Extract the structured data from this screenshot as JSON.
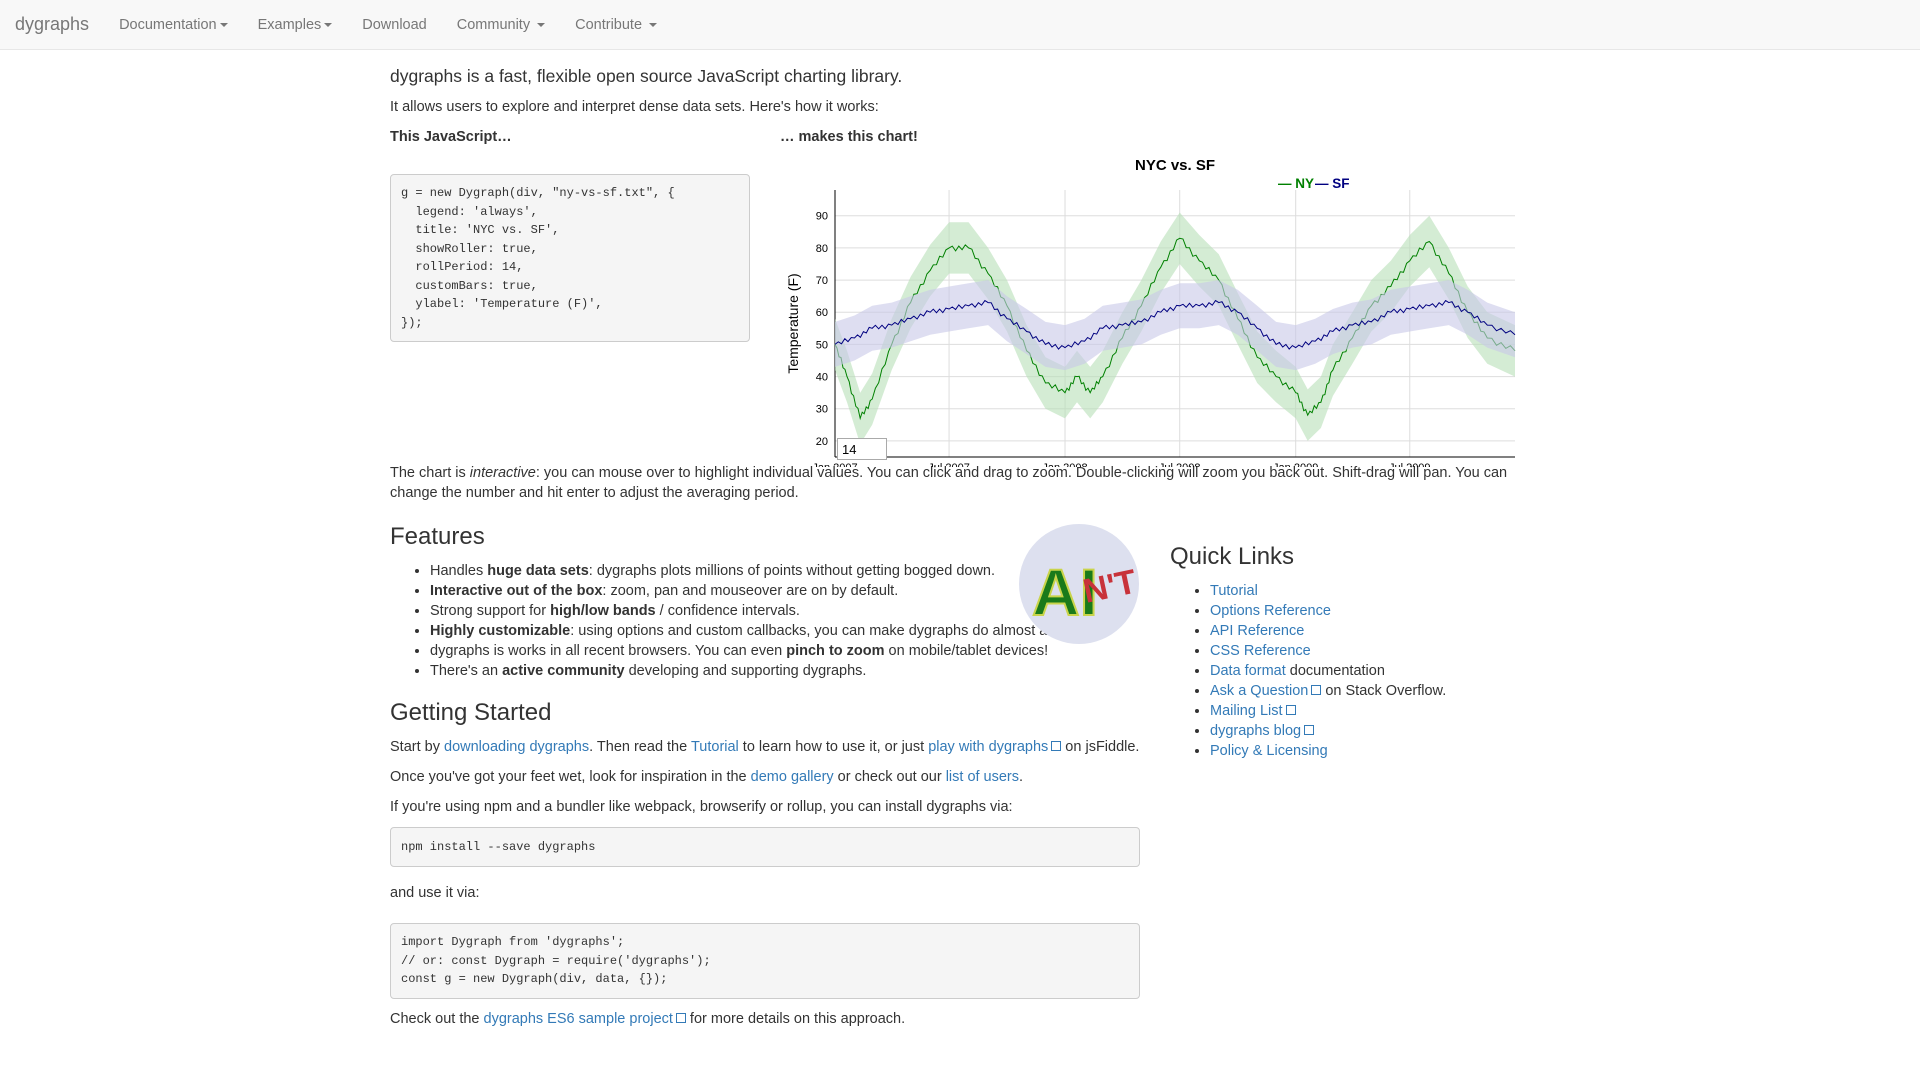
{
  "nav": {
    "brand": "dygraphs",
    "items": [
      {
        "label": "Documentation",
        "dropdown": true
      },
      {
        "label": "Examples",
        "dropdown": true
      },
      {
        "label": "Download",
        "dropdown": false
      },
      {
        "label": "Community",
        "dropdown": true
      },
      {
        "label": "Contribute",
        "dropdown": true
      }
    ]
  },
  "intro": {
    "lead": "dygraphs is a fast, flexible open source JavaScript charting library.",
    "sub": "It allows users to explore and interpret dense data sets. Here's how it works:"
  },
  "demo": {
    "js_heading": "This JavaScript…",
    "chart_heading": "… makes this chart!",
    "code": "g = new Dygraph(div, \"ny-vs-sf.txt\", {\n  legend: 'always',\n  title: 'NYC vs. SF',\n  showRoller: true,\n  rollPeriod: 14,\n  customBars: true,\n  ylabel: 'Temperature (F)',\n});",
    "interactive_before": "The chart is ",
    "interactive_em": "interactive",
    "interactive_after": ": you can mouse over to highlight individual values. You can click and drag to zoom. Double-clicking will zoom you back out. Shift-drag will pan. You can change the number and hit enter to adjust the averaging period."
  },
  "chart_data": {
    "type": "line",
    "title": "NYC vs. SF",
    "ylabel": "Temperature (F)",
    "xlabel": "",
    "x_ticks": [
      "Jan 2007",
      "Jul 2007",
      "Jan 2008",
      "Jul 2008",
      "Jan 2009",
      "Jul 2009"
    ],
    "y_ticks": [
      20,
      30,
      40,
      50,
      60,
      70,
      80,
      90
    ],
    "ylim": [
      15,
      98
    ],
    "xlim": [
      "2007-01-01",
      "2009-12-15"
    ],
    "legend_position": "top-right",
    "roller_value": "14",
    "series": [
      {
        "name": "NY",
        "color": "#008000",
        "band_color": "#b7dfb7",
        "points": [
          [
            "2007-01-01",
            50
          ],
          [
            "2007-01-20",
            40
          ],
          [
            "2007-02-10",
            27
          ],
          [
            "2007-03-01",
            33
          ],
          [
            "2007-04-01",
            50
          ],
          [
            "2007-05-01",
            63
          ],
          [
            "2007-06-01",
            73
          ],
          [
            "2007-07-01",
            80
          ],
          [
            "2007-08-01",
            80
          ],
          [
            "2007-09-01",
            72
          ],
          [
            "2007-10-01",
            62
          ],
          [
            "2007-11-01",
            48
          ],
          [
            "2007-12-01",
            38
          ],
          [
            "2008-01-01",
            35
          ],
          [
            "2008-01-20",
            40
          ],
          [
            "2008-02-10",
            35
          ],
          [
            "2008-03-01",
            40
          ],
          [
            "2008-04-01",
            52
          ],
          [
            "2008-05-01",
            62
          ],
          [
            "2008-06-01",
            74
          ],
          [
            "2008-07-01",
            83
          ],
          [
            "2008-08-01",
            76
          ],
          [
            "2008-09-01",
            70
          ],
          [
            "2008-10-01",
            58
          ],
          [
            "2008-11-01",
            46
          ],
          [
            "2008-12-01",
            40
          ],
          [
            "2009-01-01",
            35
          ],
          [
            "2009-01-20",
            28
          ],
          [
            "2009-02-10",
            32
          ],
          [
            "2009-03-01",
            42
          ],
          [
            "2009-04-01",
            52
          ],
          [
            "2009-05-01",
            62
          ],
          [
            "2009-06-01",
            68
          ],
          [
            "2009-07-01",
            76
          ],
          [
            "2009-08-01",
            82
          ],
          [
            "2009-09-01",
            72
          ],
          [
            "2009-10-01",
            60
          ],
          [
            "2009-11-01",
            52
          ],
          [
            "2009-12-15",
            48
          ]
        ]
      },
      {
        "name": "SF",
        "color": "#000080",
        "band_color": "#c8c8e8",
        "points": [
          [
            "2007-01-01",
            50
          ],
          [
            "2007-02-01",
            52
          ],
          [
            "2007-03-01",
            55
          ],
          [
            "2007-04-01",
            56
          ],
          [
            "2007-05-01",
            58
          ],
          [
            "2007-06-01",
            60
          ],
          [
            "2007-07-01",
            61
          ],
          [
            "2007-08-01",
            62
          ],
          [
            "2007-09-01",
            63
          ],
          [
            "2007-10-01",
            58
          ],
          [
            "2007-11-01",
            54
          ],
          [
            "2007-12-01",
            50
          ],
          [
            "2008-01-01",
            49
          ],
          [
            "2008-02-01",
            51
          ],
          [
            "2008-03-01",
            55
          ],
          [
            "2008-04-01",
            56
          ],
          [
            "2008-05-01",
            57
          ],
          [
            "2008-06-01",
            60
          ],
          [
            "2008-07-01",
            62
          ],
          [
            "2008-08-01",
            62
          ],
          [
            "2008-09-01",
            63
          ],
          [
            "2008-10-01",
            60
          ],
          [
            "2008-11-01",
            55
          ],
          [
            "2008-12-01",
            50
          ],
          [
            "2009-01-01",
            49
          ],
          [
            "2009-02-01",
            51
          ],
          [
            "2009-03-01",
            54
          ],
          [
            "2009-04-01",
            56
          ],
          [
            "2009-05-01",
            57
          ],
          [
            "2009-06-01",
            60
          ],
          [
            "2009-07-01",
            61
          ],
          [
            "2009-08-01",
            62
          ],
          [
            "2009-09-01",
            63
          ],
          [
            "2009-10-01",
            60
          ],
          [
            "2009-11-01",
            56
          ],
          [
            "2009-12-15",
            53
          ]
        ]
      }
    ]
  },
  "features": {
    "heading": "Features",
    "items": [
      {
        "pre": "Handles ",
        "strong": "huge data sets",
        "post": ": dygraphs plots millions of points without getting bogged down."
      },
      {
        "pre": "",
        "strong": "Interactive out of the box",
        "post": ": zoom, pan and mouseover are on by default."
      },
      {
        "pre": "Strong support for ",
        "strong": "high/low bands",
        "post": " / confidence intervals."
      },
      {
        "pre": "",
        "strong": "Highly customizable",
        "post": ": using options and custom callbacks, you can make dygraphs do almost anything."
      },
      {
        "pre": "dygraphs is works in all recent browsers. You can even ",
        "strong": "pinch to zoom",
        "post": " on mobile/tablet devices!"
      },
      {
        "pre": "There's an ",
        "strong": "active community",
        "post": " developing and supporting dygraphs."
      }
    ]
  },
  "logo": {
    "text_a": "AI",
    "text_b": "N'T"
  },
  "quick_links": {
    "heading": "Quick Links",
    "items": [
      {
        "label": "Tutorial",
        "suffix": "",
        "external": false
      },
      {
        "label": "Options Reference",
        "suffix": "",
        "external": false
      },
      {
        "label": "API Reference",
        "suffix": "",
        "external": false
      },
      {
        "label": "CSS Reference",
        "suffix": "",
        "external": false
      },
      {
        "label": "Data format",
        "suffix": " documentation",
        "external": false
      },
      {
        "label": "Ask a Question",
        "suffix": " on Stack Overflow.",
        "external": true
      },
      {
        "label": "Mailing List",
        "suffix": "",
        "external": true
      },
      {
        "label": "dygraphs blog",
        "suffix": "",
        "external": true
      },
      {
        "label": "Policy & Licensing",
        "suffix": "",
        "external": false
      }
    ]
  },
  "getting_started": {
    "heading": "Getting Started",
    "p1": {
      "t1": "Start by ",
      "l1": "downloading dygraphs",
      "t2": ". Then read the ",
      "l2": "Tutorial",
      "t3": " to learn how to use it, or just ",
      "l3": "play with dygraphs",
      "t4": " on jsFiddle."
    },
    "p2": {
      "t1": "Once you've got your feet wet, look for inspiration in the ",
      "l1": "demo gallery",
      "t2": " or check out our ",
      "l2": "list of users",
      "t3": "."
    },
    "p3": "If you're using npm and a bundler like webpack, browserify or rollup, you can install dygraphs via:",
    "code1": "npm install --save dygraphs",
    "p4": "and use it via:",
    "code2": "import Dygraph from 'dygraphs';\n// or: const Dygraph = require('dygraphs');\nconst g = new Dygraph(div, data, {});",
    "p5": {
      "t1": "Check out the ",
      "l1": "dygraphs ES6 sample project",
      "t2": " for more details on this approach."
    }
  }
}
